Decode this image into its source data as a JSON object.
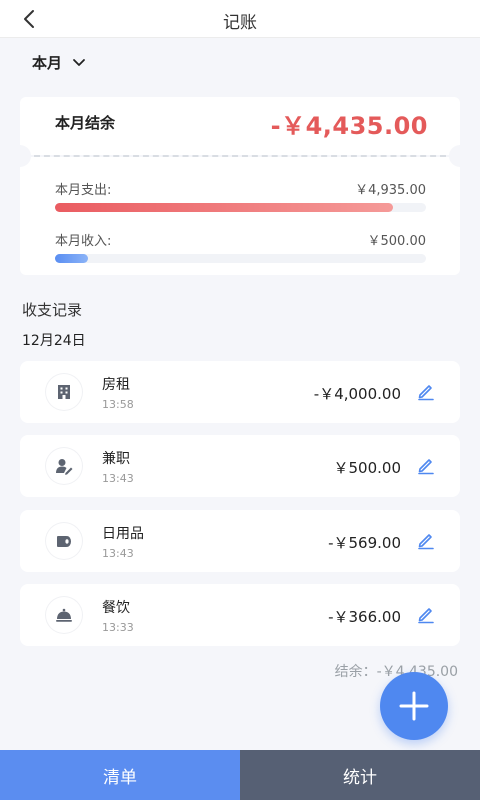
{
  "header": {
    "title": "记账"
  },
  "period": {
    "label": "本月"
  },
  "summary": {
    "balance_label": "本月结余",
    "balance_value": "-￥4,435.00",
    "expense_label": "本月支出:",
    "expense_value": "￥4,935.00",
    "expense_progress": 0.91,
    "income_label": "本月收入:",
    "income_value": "￥500.00",
    "income_progress": 0.09
  },
  "records": {
    "title": "收支记录",
    "date": "12月24日",
    "items": [
      {
        "name": "房租",
        "time": "13:58",
        "amount": "-￥4,000.00",
        "icon": "building-icon"
      },
      {
        "name": "兼职",
        "time": "13:43",
        "amount": "￥500.00",
        "icon": "worker-icon"
      },
      {
        "name": "日用品",
        "time": "13:43",
        "amount": "-￥569.00",
        "icon": "tissue-roll-icon"
      },
      {
        "name": "餐饮",
        "time": "13:33",
        "amount": "-￥366.00",
        "icon": "food-cloche-icon"
      }
    ]
  },
  "footer": {
    "total": "结余：-￥4,435.00"
  },
  "tabs": {
    "list": "清单",
    "stats": "统计"
  },
  "colors": {
    "accent": "#4f88f0",
    "negative": "#e45a5a",
    "tab_active": "#5b8df0",
    "tab_inactive": "#566074"
  }
}
